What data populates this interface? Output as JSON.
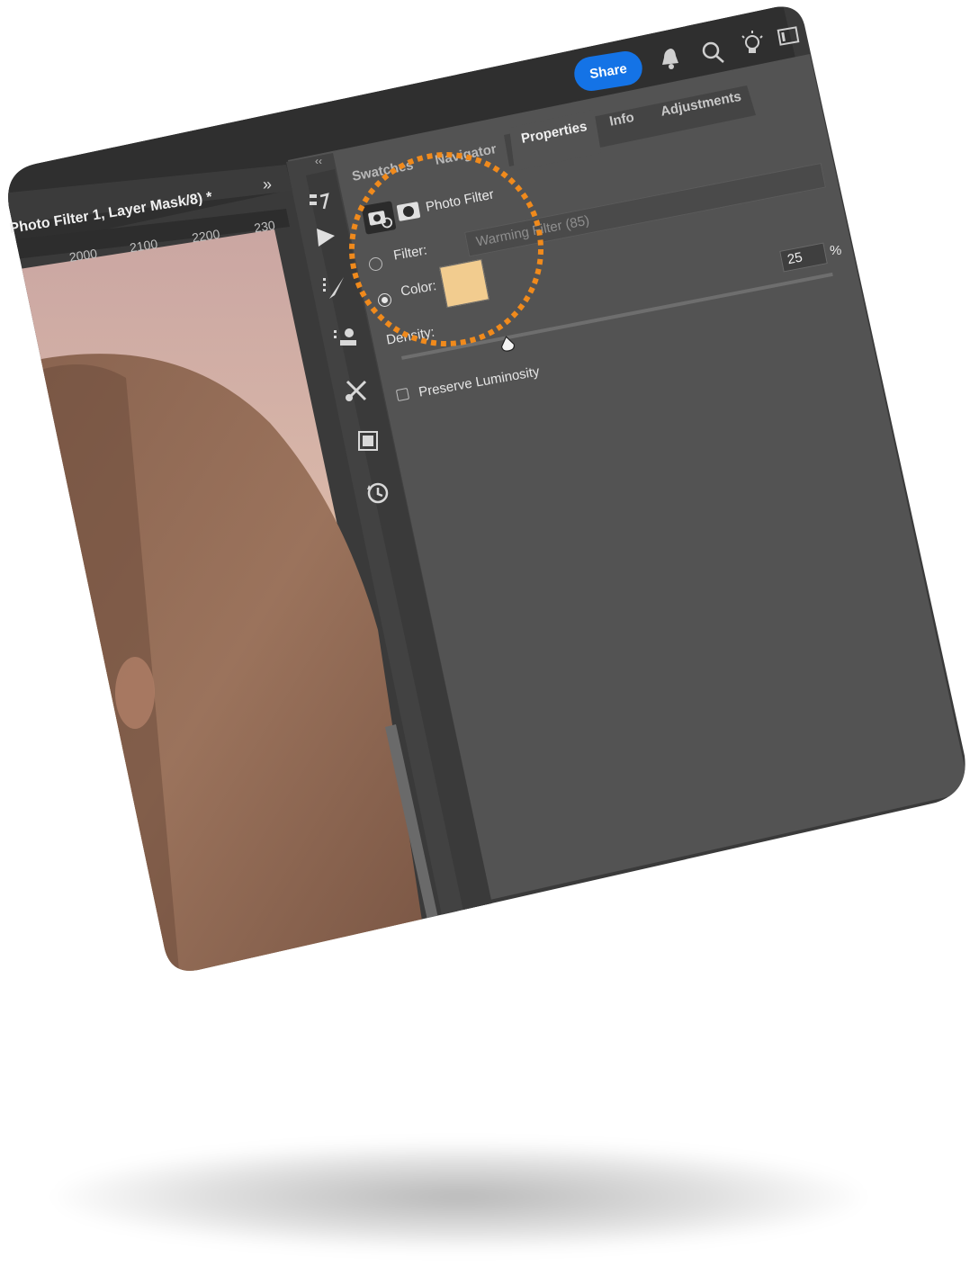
{
  "doc_tab": {
    "title": "Photo Filter 1, Layer Mask/8) *"
  },
  "ruler": {
    "marks": [
      "2000",
      "2100",
      "2200",
      "230"
    ]
  },
  "top_bar": {
    "share_label": "Share"
  },
  "panel_tabs_upper": [
    "Properties",
    "Info",
    "Adjustments"
  ],
  "panel_tabs_lower": [
    "Swatches",
    "Navigator"
  ],
  "properties": {
    "adjustment_name": "Photo Filter",
    "filter_label": "Filter:",
    "filter_value": "Warming Filter (85)",
    "color_label": "Color:",
    "color_swatch": "#f2cc8f",
    "density_label": "Density:",
    "density_value": "25",
    "density_unit": "%",
    "density_level": 25,
    "preserve_label": "Preserve Luminosity"
  },
  "colors": {
    "panel_bg": "#535353",
    "dark_bg": "#3b3b3b",
    "share_blue": "#1473e6",
    "highlight_orange": "#f08a1c"
  }
}
